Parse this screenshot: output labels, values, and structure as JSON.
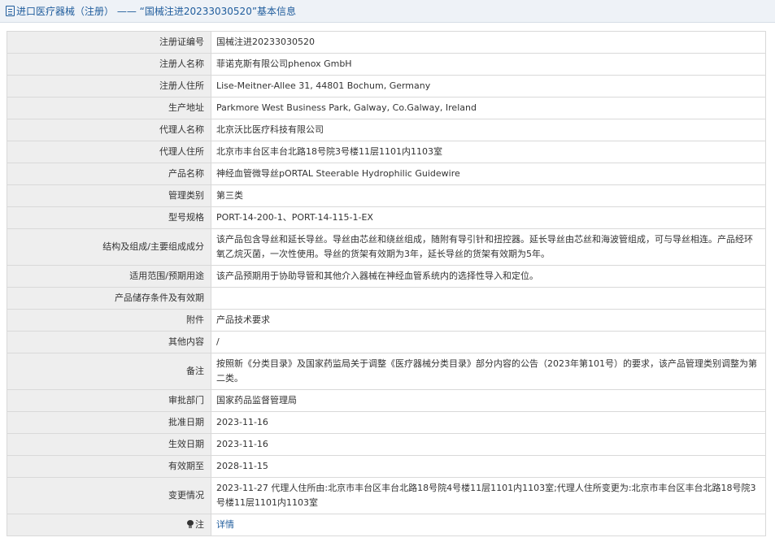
{
  "header": {
    "title": "进口医疗器械（注册） —— “国械注进20233030520”基本信息"
  },
  "rows": [
    {
      "label": "注册证编号",
      "value": "国械注进20233030520"
    },
    {
      "label": "注册人名称",
      "value": "菲诺克斯有限公司phenox GmbH"
    },
    {
      "label": "注册人住所",
      "value": "Lise-Meitner-Allee 31, 44801 Bochum, Germany"
    },
    {
      "label": "生产地址",
      "value": "Parkmore West Business Park, Galway, Co.Galway, Ireland"
    },
    {
      "label": "代理人名称",
      "value": "北京沃比医疗科技有限公司"
    },
    {
      "label": "代理人住所",
      "value": "北京市丰台区丰台北路18号院3号楼11层1101内1103室"
    },
    {
      "label": "产品名称",
      "value": "神经血管微导丝pORTAL Steerable Hydrophilic Guidewire"
    },
    {
      "label": "管理类别",
      "value": "第三类"
    },
    {
      "label": "型号规格",
      "value": "PORT-14-200-1、PORT-14-115-1-EX"
    },
    {
      "label": "结构及组成/主要组成成分",
      "value": "该产品包含导丝和延长导丝。导丝由芯丝和绕丝组成，随附有导引针和扭控器。延长导丝由芯丝和海波管组成，可与导丝相连。产品经环氧乙烷灭菌，一次性使用。导丝的货架有效期为3年，延长导丝的货架有效期为5年。"
    },
    {
      "label": "适用范围/预期用途",
      "value": "该产品预期用于协助导管和其他介入器械在神经血管系统内的选择性导入和定位。"
    },
    {
      "label": "产品储存条件及有效期",
      "value": ""
    },
    {
      "label": "附件",
      "value": "产品技术要求"
    },
    {
      "label": "其他内容",
      "value": "/"
    },
    {
      "label": "备注",
      "value": "按照新《分类目录》及国家药监局关于调整《医疗器械分类目录》部分内容的公告（2023年第101号）的要求，该产品管理类别调整为第二类。"
    },
    {
      "label": "审批部门",
      "value": "国家药品监督管理局"
    },
    {
      "label": "批准日期",
      "value": "2023-11-16"
    },
    {
      "label": "生效日期",
      "value": "2023-11-16"
    },
    {
      "label": "有效期至",
      "value": "2028-11-15"
    },
    {
      "label": "变更情况",
      "value": "2023-11-27 代理人住所由:北京市丰台区丰台北路18号院4号楼11层1101内1103室;代理人住所变更为:北京市丰台区丰台北路18号院3号楼11层1101内1103室"
    }
  ],
  "note": {
    "label": "注",
    "icon": "lightbulb-icon",
    "link_text": "详情",
    "link_color": "#1f5c9c"
  }
}
